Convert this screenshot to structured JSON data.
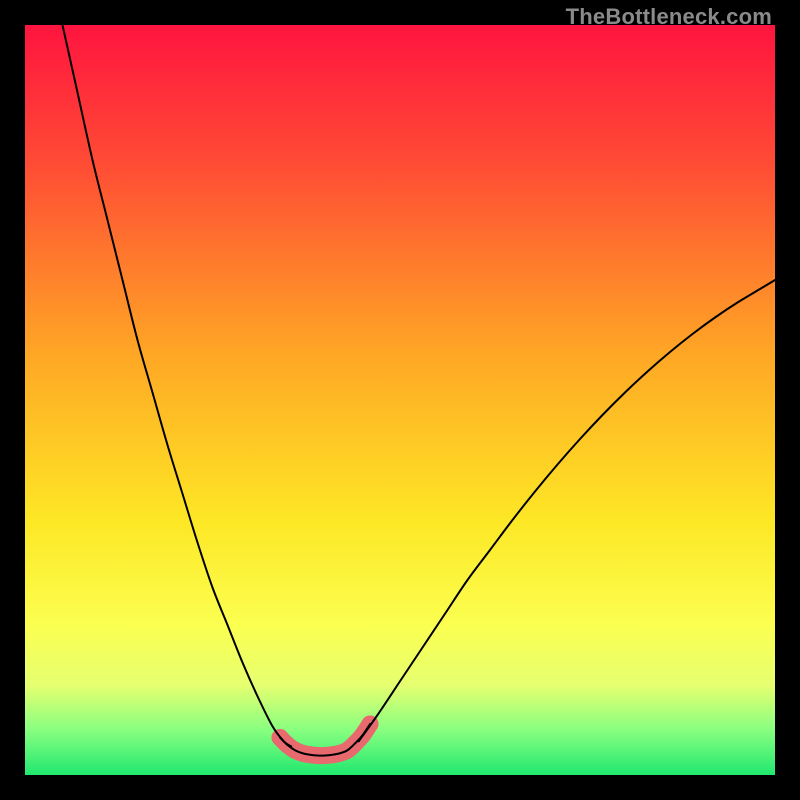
{
  "watermark": "TheBottleneck.com",
  "chart_data": {
    "type": "line",
    "title": "",
    "xlabel": "",
    "ylabel": "",
    "xlim": [
      0,
      100
    ],
    "ylim": [
      0,
      100
    ],
    "series": [
      {
        "name": "left-descending-curve",
        "x": [
          5,
          7,
          9,
          11,
          13,
          15,
          17,
          19,
          21,
          23,
          25,
          27,
          29,
          31,
          33,
          34.5,
          35.5
        ],
        "values": [
          100,
          91,
          82,
          74,
          66,
          58,
          51,
          44,
          37.5,
          31,
          25,
          20,
          15,
          10.5,
          6.5,
          4.5,
          3.8
        ]
      },
      {
        "name": "valley-floor",
        "x": [
          34,
          35,
          36,
          37,
          38,
          39,
          40,
          41,
          42,
          43,
          44,
          45,
          46
        ],
        "values": [
          5,
          4,
          3.3,
          2.9,
          2.7,
          2.6,
          2.6,
          2.7,
          2.9,
          3.3,
          4.2,
          5.3,
          6.8
        ]
      },
      {
        "name": "right-ascending-curve",
        "x": [
          44.5,
          47,
          50,
          53,
          56,
          59,
          62,
          65,
          68,
          71,
          74,
          77,
          80,
          83,
          86,
          89,
          92,
          95,
          98,
          100
        ],
        "values": [
          4.5,
          8,
          12.5,
          17,
          21.5,
          26,
          30,
          34,
          37.8,
          41.4,
          44.8,
          48,
          51,
          53.8,
          56.4,
          58.8,
          61,
          63,
          64.8,
          66
        ]
      }
    ],
    "annotations": [
      {
        "text": "TheBottleneck.com",
        "position": "top-right"
      }
    ]
  },
  "style": {
    "valley_highlight_color": "#e86a6f",
    "curve_color": "#000000",
    "frame_color": "#000000"
  }
}
